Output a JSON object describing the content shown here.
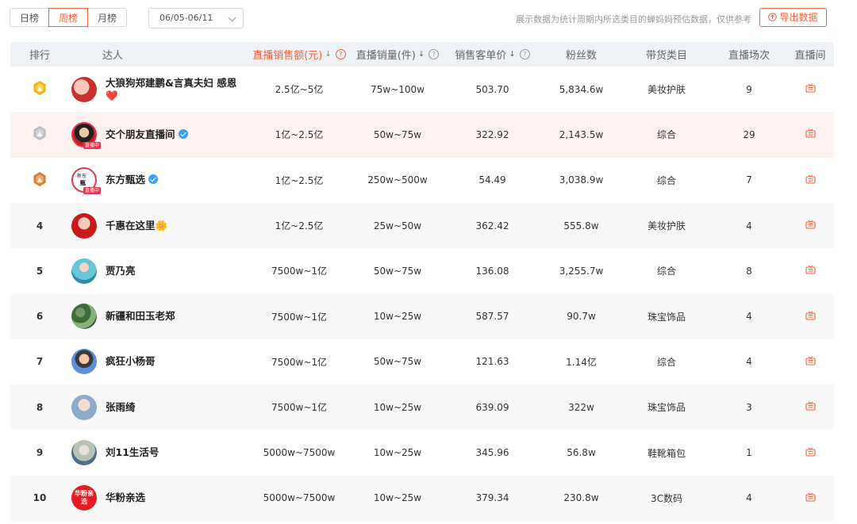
{
  "toolbar": {
    "tabs": [
      {
        "label": "日榜",
        "active": false
      },
      {
        "label": "周榜",
        "active": true
      },
      {
        "label": "月榜",
        "active": false
      }
    ],
    "date_range": "06/05-06/11",
    "note": "展示数据为统计周期内所选类目的蝉妈妈预估数据，仅供参考",
    "export_label": "导出数据"
  },
  "colors": {
    "accent": "#f0623a",
    "header_bg": "#eef2f7",
    "highlight_row": "#fdf2ef",
    "gold": "#f5b400",
    "silver": "#b9bec6",
    "bronze": "#e07a2a",
    "verified": "#3aa0f5",
    "live_tag": "#e8344f"
  },
  "table": {
    "columns": {
      "rank": "排行",
      "name": "达人",
      "gmv": "直播销售额(元)",
      "volume": "直播销量(件)",
      "price": "销售客单价",
      "fans": "粉丝数",
      "category": "带货类目",
      "count": "直播场次",
      "live": "直播间"
    },
    "rows": [
      {
        "rank": "1",
        "medal": "gold",
        "name": "大狼狗郑建鹏&言真夫妇 感恩❤️",
        "verified": false,
        "live": false,
        "gmv": "2.5亿~5亿",
        "volume": "75w~100w",
        "price": "503.70",
        "fans": "5,834.6w",
        "category": "美妆护肤",
        "count": "9"
      },
      {
        "rank": "2",
        "medal": "silver",
        "name": "交个朋友直播间",
        "verified": true,
        "live": true,
        "gmv": "1亿~2.5亿",
        "volume": "50w~75w",
        "price": "322.92",
        "fans": "2,143.5w",
        "category": "综合",
        "count": "29"
      },
      {
        "rank": "3",
        "medal": "bronze",
        "name": "东方甄选",
        "verified": true,
        "live": true,
        "gmv": "1亿~2.5亿",
        "volume": "250w~500w",
        "price": "54.49",
        "fans": "3,038.9w",
        "category": "综合",
        "count": "7"
      },
      {
        "rank": "4",
        "medal": "",
        "name": "千惠在这里🌼",
        "verified": false,
        "live": false,
        "gmv": "1亿~2.5亿",
        "volume": "25w~50w",
        "price": "362.42",
        "fans": "555.8w",
        "category": "美妆护肤",
        "count": "4"
      },
      {
        "rank": "5",
        "medal": "",
        "name": "贾乃亮",
        "verified": false,
        "live": false,
        "gmv": "7500w~1亿",
        "volume": "50w~75w",
        "price": "136.08",
        "fans": "3,255.7w",
        "category": "综合",
        "count": "8"
      },
      {
        "rank": "6",
        "medal": "",
        "name": "新疆和田玉老郑",
        "verified": false,
        "live": false,
        "gmv": "7500w~1亿",
        "volume": "10w~25w",
        "price": "587.57",
        "fans": "90.7w",
        "category": "珠宝饰品",
        "count": "4"
      },
      {
        "rank": "7",
        "medal": "",
        "name": "疯狂小杨哥",
        "verified": false,
        "live": false,
        "gmv": "7500w~1亿",
        "volume": "50w~75w",
        "price": "121.63",
        "fans": "1.14亿",
        "category": "综合",
        "count": "4"
      },
      {
        "rank": "8",
        "medal": "",
        "name": "张雨绮",
        "verified": false,
        "live": false,
        "gmv": "7500w~1亿",
        "volume": "10w~25w",
        "price": "639.09",
        "fans": "322w",
        "category": "珠宝饰品",
        "count": "3"
      },
      {
        "rank": "9",
        "medal": "",
        "name": "刘11生活号",
        "verified": false,
        "live": false,
        "gmv": "5000w~7500w",
        "volume": "10w~25w",
        "price": "345.96",
        "fans": "56.8w",
        "category": "鞋靴箱包",
        "count": "1"
      },
      {
        "rank": "10",
        "medal": "",
        "name": "华粉亲选",
        "verified": false,
        "live": false,
        "gmv": "5000w~7500w",
        "volume": "10w~25w",
        "price": "379.34",
        "fans": "230.8w",
        "category": "3C数码",
        "count": "4"
      }
    ],
    "live_tag_label": "直播中",
    "avatar_text_10": "华粉亲选"
  }
}
